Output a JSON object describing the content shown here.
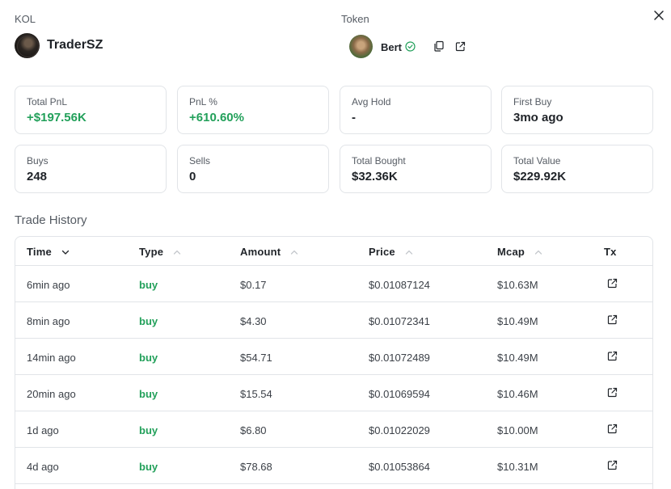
{
  "header": {
    "kol_label": "KOL",
    "kol_name": "TraderSZ",
    "token_label": "Token",
    "token_name": "Bert"
  },
  "stats": [
    {
      "label": "Total PnL",
      "value": "+$197.56K",
      "positive": true
    },
    {
      "label": "PnL %",
      "value": "+610.60%",
      "positive": true
    },
    {
      "label": "Avg Hold",
      "value": "-",
      "positive": false
    },
    {
      "label": "First Buy",
      "value": "3mo ago",
      "positive": false
    },
    {
      "label": "Buys",
      "value": "248",
      "positive": false
    },
    {
      "label": "Sells",
      "value": "0",
      "positive": false
    },
    {
      "label": "Total Bought",
      "value": "$32.36K",
      "positive": false
    },
    {
      "label": "Total Value",
      "value": "$229.92K",
      "positive": false
    }
  ],
  "trade_history": {
    "title": "Trade History",
    "columns": {
      "time": "Time",
      "type": "Type",
      "amount": "Amount",
      "price": "Price",
      "mcap": "Mcap",
      "tx": "Tx"
    },
    "rows": [
      {
        "time": "6min ago",
        "type": "buy",
        "amount": "$0.17",
        "price": "$0.01087124",
        "mcap": "$10.63M"
      },
      {
        "time": "8min ago",
        "type": "buy",
        "amount": "$4.30",
        "price": "$0.01072341",
        "mcap": "$10.49M"
      },
      {
        "time": "14min ago",
        "type": "buy",
        "amount": "$54.71",
        "price": "$0.01072489",
        "mcap": "$10.49M"
      },
      {
        "time": "20min ago",
        "type": "buy",
        "amount": "$15.54",
        "price": "$0.01069594",
        "mcap": "$10.46M"
      },
      {
        "time": "1d ago",
        "type": "buy",
        "amount": "$6.80",
        "price": "$0.01022029",
        "mcap": "$10.00M"
      },
      {
        "time": "4d ago",
        "type": "buy",
        "amount": "$78.68",
        "price": "$0.01053864",
        "mcap": "$10.31M"
      }
    ]
  },
  "colors": {
    "positive": "#22a05a",
    "border": "#e1e4e8",
    "muted": "#555b63"
  },
  "icons": [
    "close-icon",
    "verified-icon",
    "copy-icon",
    "external-link-icon",
    "chevron-down-icon",
    "chevron-up-icon"
  ]
}
